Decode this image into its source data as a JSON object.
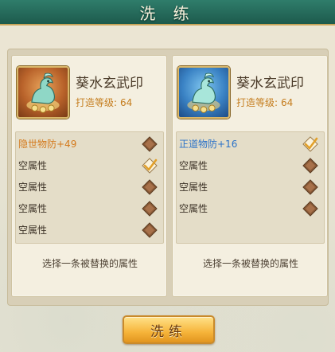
{
  "window": {
    "title": "洗 练"
  },
  "colors": {
    "titlebar": "#1d5a4c",
    "accent_orange": "#d47a1d",
    "accent_blue": "#2b72c8",
    "level_text": "#c57d1e"
  },
  "left_panel": {
    "icon": "turtle-snake-seal-icon",
    "frame_color": "orange",
    "name": "葵水玄武印",
    "level_label": "打造等级:",
    "level_value": "64",
    "attributes": [
      {
        "text": "隐世物防+49",
        "checked": false,
        "highlight": "orange"
      },
      {
        "text": "空属性",
        "checked": true,
        "highlight": ""
      },
      {
        "text": "空属性",
        "checked": false,
        "highlight": ""
      },
      {
        "text": "空属性",
        "checked": false,
        "highlight": ""
      },
      {
        "text": "空属性",
        "checked": false,
        "highlight": ""
      }
    ],
    "hint": "选择一条被替换的属性"
  },
  "right_panel": {
    "icon": "turtle-snake-seal-icon",
    "frame_color": "blue",
    "name": "葵水玄武印",
    "level_label": "打造等级:",
    "level_value": "64",
    "attributes": [
      {
        "text": "正道物防+16",
        "checked": true,
        "highlight": "blue"
      },
      {
        "text": "空属性",
        "checked": false,
        "highlight": ""
      },
      {
        "text": "空属性",
        "checked": false,
        "highlight": ""
      },
      {
        "text": "空属性",
        "checked": false,
        "highlight": ""
      }
    ],
    "hint": "选择一条被替换的属性"
  },
  "footer": {
    "wash_button_label": "洗练"
  }
}
